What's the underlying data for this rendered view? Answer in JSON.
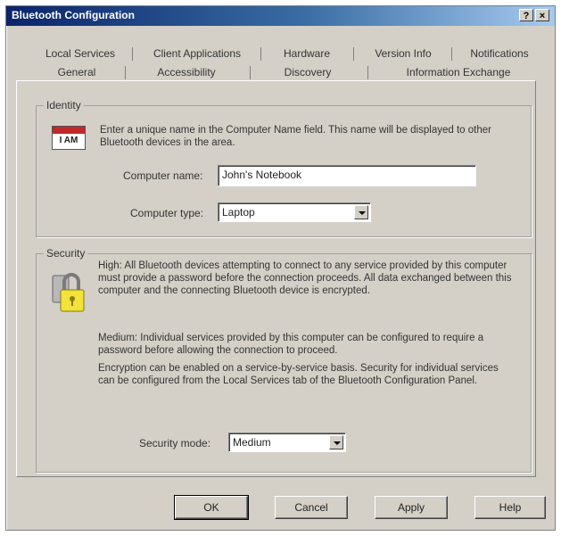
{
  "window": {
    "title": "Bluetooth Configuration",
    "help_glyph": "?",
    "close_glyph": "×"
  },
  "tabs_back": [
    "Local Services",
    "Client Applications",
    "Hardware",
    "Version Info",
    "Notifications"
  ],
  "tabs_front": [
    "General",
    "Accessibility",
    "Discovery",
    "Information Exchange"
  ],
  "identity": {
    "legend": "Identity",
    "description": "Enter a unique name in the Computer Name field. This name will be displayed to other Bluetooth devices in the area.",
    "icon_text": "I AM",
    "computer_name_label": "Computer name:",
    "computer_name_value": "John's Notebook",
    "computer_type_label": "Computer type:",
    "computer_type_value": "Laptop"
  },
  "security": {
    "legend": "Security",
    "high_text": "High: All Bluetooth devices attempting to connect to any service provided by this computer must provide a password before the connection proceeds. All data exchanged between this computer and the connecting Bluetooth device is encrypted.",
    "medium_text": "Medium: Individual services provided by this computer can be configured to require a password before allowing the connection to proceed.",
    "encryption_text": "Encryption can be enabled on a service-by-service basis. Security for individual services can be configured from the Local Services tab of the Bluetooth Configuration Panel.",
    "mode_label": "Security mode:",
    "mode_value": "Medium"
  },
  "buttons": {
    "ok": "OK",
    "cancel": "Cancel",
    "apply": "Apply",
    "help": "Help"
  }
}
